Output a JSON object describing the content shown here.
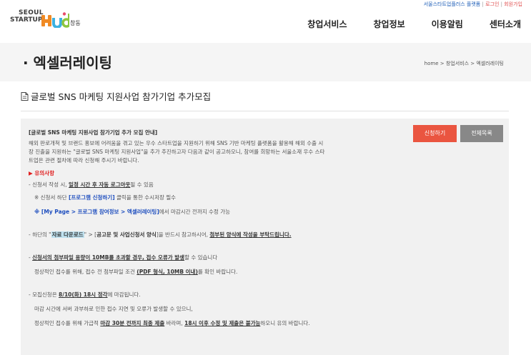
{
  "header": {
    "logo": {
      "line1": "SEOUL",
      "line2": "STARTUP",
      "hub": "hub",
      "sub": "창동"
    },
    "util": [
      {
        "label": "서울스타트업플러스 플랫폼"
      },
      {
        "label": "로그인"
      },
      {
        "label": "회원가입"
      }
    ],
    "util_sep": "|",
    "nav": [
      {
        "label": "창업서비스"
      },
      {
        "label": "창업정보"
      },
      {
        "label": "이용알림"
      },
      {
        "label": "센터소개"
      }
    ]
  },
  "page": {
    "title": "· 엑셀러레이팅",
    "breadcrumb": "home > 창업서비스 > 엑셀러레이팅"
  },
  "subject": "글로벌 SNS 마케팅 지원사업 참가기업 추가모집",
  "buttons": {
    "apply": "신청하기",
    "list": "전체목록"
  },
  "body": {
    "title": "[글로벌 SNS 마케팅 지원사업 참가기업 추가 모집 안내]",
    "intro1": "해외 판로개척 및 브랜드 홍보에 어려움을 겪고 있는 우수 스타트업을 지원하기 위해 SNS 기반 마케팅 플랫폼을 활용해 해외 수출 시",
    "intro2": "장 진출을 지원하는 \"글로벌 SNS 마케팅 지원사업\"을 추가 추진하고자 다음과 같이 공고하오니, 참여를 희망하는 서울소재 우수 스타",
    "intro3": "트업은 관련 절차에 따라 신청해 주시기 바랍니다.",
    "notice_head": "▶ 유의사항",
    "n1_pre": "- 신청서 작성 시,",
    "n1_bold": "일정 시간 후 자동 로그아웃",
    "n1_post": "될 수 있음",
    "n2_pre": "※ 신청서 하단",
    "n2_blue": "[프로그램 신청하기]",
    "n2_post": "클릭을 통한 수시저장 필수",
    "n3_blue": "※ [My Page > 프로그램 참여정보 > 엑셀러레이팅]",
    "n3_post": "에서 마감시간 전까지 수정 가능",
    "n4_pre": "- 하단의 \"",
    "n4_hl": "자료 다운로드",
    "n4_mid1": "\" > [",
    "n4_bold": "공고문 및 사업신청서 양식",
    "n4_mid2": "]을 반드시 참고하시어,",
    "n4_ul": "첨부된 양식에 작성을 부탁드립니다.",
    "n5_pre": "-",
    "n5_bold": "신청서의 첨부파일 용량이 10MB를 초과할 경우, 접수 오류가 발생",
    "n5_post": "할 수 있습니다",
    "n6_pre": "정상적인 접수를 위해, 접수 전 첨부파일 조건",
    "n6_bold": "(PDF 형식, 10MB 이내)",
    "n6_post": "를 확인 바랍니다.",
    "n7_pre": "- 모집신청은",
    "n7_red": "8/10(화) 18시 정각",
    "n7_post": "에 마감됩니다.",
    "n8": "마감 시간에 서버 과부하로 인한 접수 지연 및 오류가 발생할 수 있으니,",
    "n9_pre": "정상적인 접수를 위해 가급적",
    "n9_bold1": "마감 30분 전까지 최종 제출",
    "n9_mid": "바라며,",
    "n9_bold2": "18시 이후 수정 및 제출은 불가능",
    "n9_post": "하오니 유의 바랍니다."
  },
  "colors": {
    "accent": "#ea5540",
    "gray_button": "#888888",
    "notice_red": "#e02020",
    "link_blue": "#1f4fbf",
    "highlight": "#bfe1ef"
  }
}
